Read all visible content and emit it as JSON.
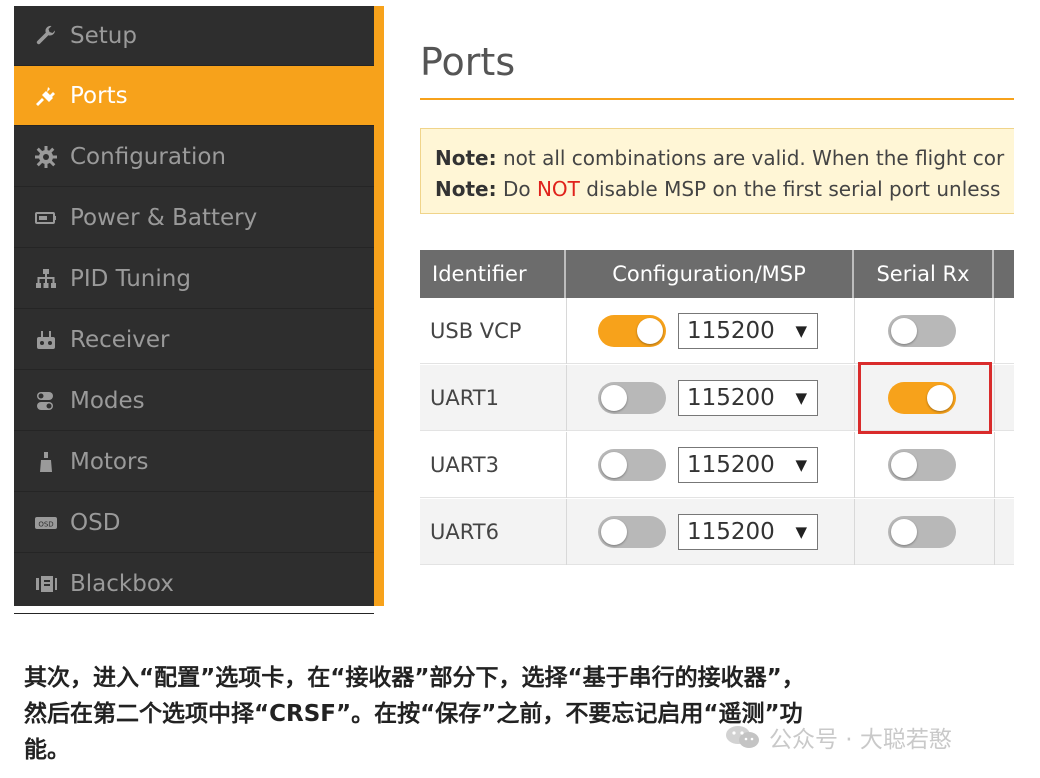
{
  "sidebar": {
    "items": [
      {
        "label": "Setup",
        "icon": "wrench-icon",
        "active": false
      },
      {
        "label": "Ports",
        "icon": "plug-icon",
        "active": true
      },
      {
        "label": "Configuration",
        "icon": "gear-icon",
        "active": false
      },
      {
        "label": "Power & Battery",
        "icon": "battery-icon",
        "active": false
      },
      {
        "label": "PID Tuning",
        "icon": "pid-tree-icon",
        "active": false
      },
      {
        "label": "Receiver",
        "icon": "receiver-icon",
        "active": false
      },
      {
        "label": "Modes",
        "icon": "modes-icon",
        "active": false
      },
      {
        "label": "Motors",
        "icon": "motor-icon",
        "active": false
      },
      {
        "label": "OSD",
        "icon": "osd-icon",
        "active": false
      },
      {
        "label": "Blackbox",
        "icon": "blackbox-icon",
        "active": false
      }
    ],
    "accent": "#f7a21b"
  },
  "main": {
    "title": "Ports",
    "notes": [
      {
        "label": "Note:",
        "text": " not all combinations are valid. When the flight cor"
      },
      {
        "label": "Note:",
        "pre": " Do ",
        "highlight": "NOT",
        "post": " disable MSP on the first serial port unless"
      }
    ],
    "table": {
      "headers": [
        "Identifier",
        "Configuration/MSP",
        "Serial Rx"
      ],
      "rows": [
        {
          "id": "USB VCP",
          "msp_on": true,
          "baud": "115200",
          "serial_rx_on": false
        },
        {
          "id": "UART1",
          "msp_on": false,
          "baud": "115200",
          "serial_rx_on": true
        },
        {
          "id": "UART3",
          "msp_on": false,
          "baud": "115200",
          "serial_rx_on": false
        },
        {
          "id": "UART6",
          "msp_on": false,
          "baud": "115200",
          "serial_rx_on": false
        }
      ],
      "select_arrow": "▼"
    }
  },
  "caption": {
    "line1": "其次，进入“配置”选项卡，在“接收器”部分下，选择“基于串行的接收器”，",
    "line2": "然后在第二个选项中择“CRSF”。在按“保存”之前，不要忘记启用“遥测”功",
    "line3": "能。"
  },
  "watermark": {
    "text": "公众号 · 大聪若憨"
  },
  "colors": {
    "accent": "#f7a21b",
    "highlight_box": "#d92b2b",
    "note_red": "#e0231c"
  }
}
